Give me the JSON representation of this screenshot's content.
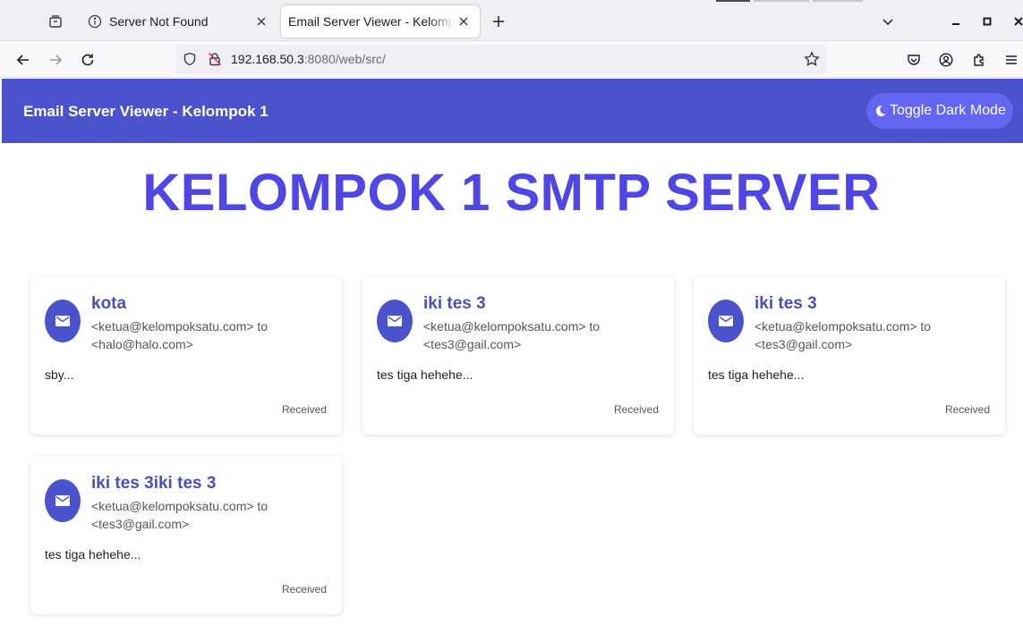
{
  "browser": {
    "tabs": [
      {
        "title": "Server Not Found",
        "active": false,
        "icon": "info-icon"
      },
      {
        "title": "Email Server Viewer - Kelompok 1",
        "active": true,
        "icon": "none"
      }
    ],
    "url_host": "192.168.50.3",
    "url_rest": ":8080/web/src/"
  },
  "app": {
    "header_title": "Email Server Viewer - Kelompok 1",
    "dark_mode_label": "Toggle Dark Mode",
    "hero_title": "KELOMPOK 1 SMTP SERVER",
    "accent_color": "#4b53cc",
    "hero_color": "#4f46e5"
  },
  "emails": [
    {
      "subject": "kota",
      "from": "<ketua@kelompoksatu.com>",
      "to_word": "to",
      "to": "<halo@halo.com>",
      "preview": "sby...",
      "status": "Received"
    },
    {
      "subject": "iki tes 3",
      "from": "<ketua@kelompoksatu.com>",
      "to_word": "to",
      "to": "<tes3@gail.com>",
      "preview": "tes tiga hehehe...",
      "status": "Received"
    },
    {
      "subject": "iki tes 3",
      "from": "<ketua@kelompoksatu.com>",
      "to_word": "to",
      "to": "<tes3@gail.com>",
      "preview": "tes tiga hehehe...",
      "status": "Received"
    },
    {
      "subject": "iki tes 3iki tes 3",
      "from": "<ketua@kelompoksatu.com>",
      "to_word": "to",
      "to": "<tes3@gail.com>",
      "preview": "tes tiga hehehe...",
      "status": "Received"
    }
  ]
}
